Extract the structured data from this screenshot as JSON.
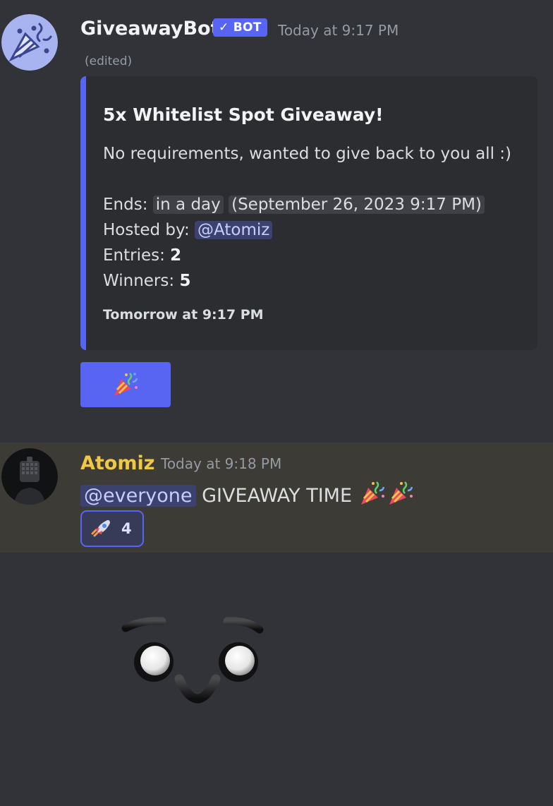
{
  "messages": {
    "bot": {
      "username": "GiveawayBot",
      "badge": "✓ BOT",
      "timestamp": "Today at 9:17 PM",
      "edited": "(edited)",
      "avatar_icon": "party-popper-icon",
      "embed": {
        "accent_color": "#5865f2",
        "title": "5x Whitelist Spot Giveaway!",
        "description": "No requirements, wanted to give back to you all :)",
        "ends_label": "Ends:",
        "ends_relative": "in a day",
        "ends_absolute": "September 26, 2023 9:17 PM",
        "hosted_label": "Hosted by:",
        "host_mention": "@Atomiz",
        "entries_label": "Entries:",
        "entries_value": "2",
        "winners_label": "Winners:",
        "winners_value": "5",
        "footer": "Tomorrow at 9:17 PM"
      },
      "button": {
        "icon": "party-popper-icon",
        "color": "#5865f2"
      }
    },
    "user": {
      "username": "Atomiz",
      "username_color": "#f0c844",
      "timestamp": "Today at 9:18 PM",
      "mention": "@everyone",
      "text": "GIVEAWAY TIME",
      "emojis": [
        "party-popper-icon",
        "party-popper-icon"
      ],
      "reaction": {
        "emoji": "rocket-icon",
        "count": "4"
      },
      "sticker_icon": "smiling-face-sticker"
    }
  }
}
